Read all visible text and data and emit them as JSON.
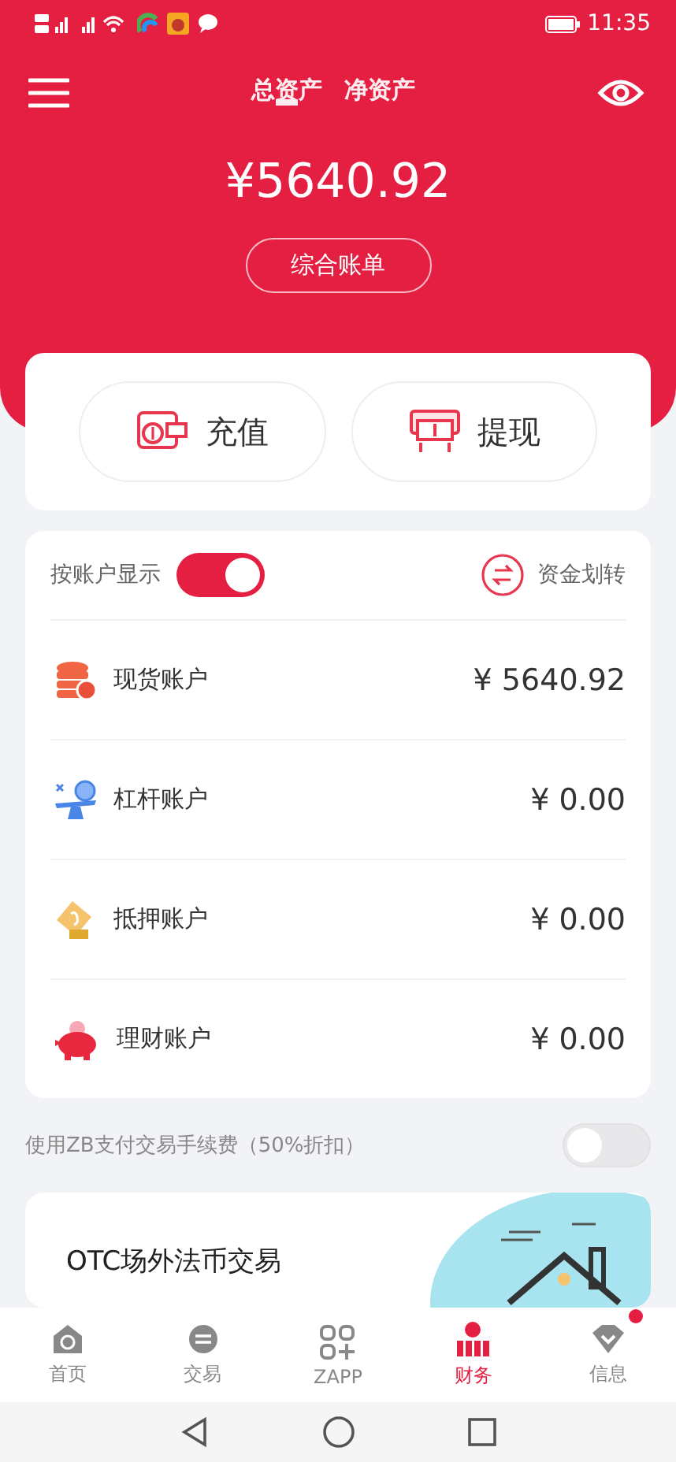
{
  "status_bar": {
    "time": "11:35"
  },
  "header": {
    "tabs": [
      {
        "label": "总资产",
        "selected": true
      },
      {
        "label": "净资产",
        "selected": false
      }
    ],
    "total": "¥5640.92",
    "statement_button": "综合账单"
  },
  "actions": [
    {
      "label": "充值",
      "kind": "deposit"
    },
    {
      "label": "提现",
      "kind": "withdraw"
    }
  ],
  "accounts_panel": {
    "toggle_label": "按账户显示",
    "toggle_on": true,
    "transfer_label": "资金划转",
    "accounts": [
      {
        "name": "现货账户",
        "balance": "¥ 5640.92",
        "kind": "spot"
      },
      {
        "name": "杠杆账户",
        "balance": "¥ 0.00",
        "kind": "margin"
      },
      {
        "name": "抵押账户",
        "balance": "¥ 0.00",
        "kind": "pledge"
      },
      {
        "name": "理财账户",
        "balance": "¥ 0.00",
        "kind": "savings"
      }
    ]
  },
  "fee_option": {
    "label": "使用ZB支付交易手续费（50%折扣）",
    "on": false
  },
  "banner": {
    "title": "OTC场外法币交易"
  },
  "tab_bar": [
    {
      "label": "首页",
      "selected": false,
      "badge": false,
      "kind": "home"
    },
    {
      "label": "交易",
      "selected": false,
      "badge": false,
      "kind": "trade"
    },
    {
      "label": "ZAPP",
      "selected": false,
      "badge": false,
      "kind": "apps"
    },
    {
      "label": "财务",
      "selected": true,
      "badge": false,
      "kind": "finance"
    },
    {
      "label": "信息",
      "selected": false,
      "badge": true,
      "kind": "info"
    }
  ]
}
